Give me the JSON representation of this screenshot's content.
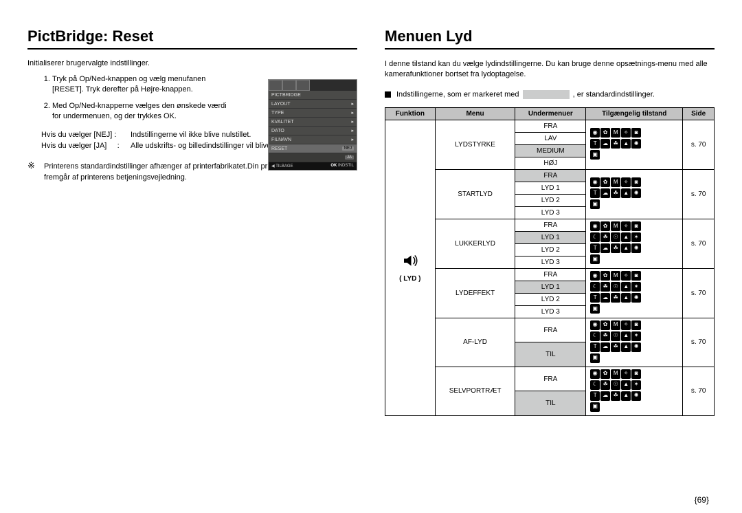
{
  "left": {
    "title": "PictBridge: Reset",
    "intro": "Initialiserer brugervalgte indstillinger.",
    "step1": "Tryk på Op/Ned-knappen og vælg menufanen [RESET]. Tryk derefter på Højre-knappen.",
    "step2": "Med Op/Ned-knapperne vælges den ønskede værdi for undermenuen, og der trykkes OK.",
    "nej_label": "Hvis du vælger [NEJ]",
    "nej_colon": ":",
    "nej_desc": "Indstillingerne vil ikke blive nulstillet.",
    "ja_label": "Hvis du vælger [JA]",
    "ja_colon": ":",
    "ja_desc": "Alle udskrifts- og billedindstillinger vil blive nulstillet.",
    "note": "Printerens standardindstillinger afhænger af printerfabrikatet.Din printers standardindstillinger fremgår af printerens betjeningsvejledning.",
    "note_glyph": "※",
    "screenshot": {
      "title": "PICTBRIDGE",
      "items": [
        "LAYOUT",
        "TYPE",
        "KVALITET",
        "DATO",
        "FILNAVN",
        "RESET"
      ],
      "reset_opts": [
        "NEJ",
        "JA"
      ],
      "bottom_back_arrow": "◀",
      "bottom_back": "TILBAGE",
      "bottom_ok": "OK",
      "bottom_set": "INDSTIL"
    }
  },
  "right": {
    "title": "Menuen Lyd",
    "intro": "I denne tilstand kan du vælge lydindstillingerne. Du kan bruge denne opsætnings-menu med alle kamerafunktioner bortset fra lydoptagelse.",
    "bullet_prefix": "Indstillingerne, som er markeret med",
    "bullet_suffix": ", er standardindstillinger.",
    "headers": {
      "funktion": "Funktion",
      "menu": "Menu",
      "undermenuer": "Undermenuer",
      "tilstand": "Tilgængelig tilstand",
      "side": "Side"
    },
    "funktion_label": "( LYD )",
    "menus": {
      "lydstyrke": {
        "name": "LYDSTYRKE",
        "subs": [
          "FRA",
          "LAV",
          "MEDIUM",
          "HØJ"
        ],
        "default_idx": 2,
        "page": "s. 70"
      },
      "startlyd": {
        "name": "STARTLYD",
        "subs": [
          "FRA",
          "LYD 1",
          "LYD 2",
          "LYD 3"
        ],
        "default_idx": 0,
        "page": "s. 70"
      },
      "lukkerlyd": {
        "name": "LUKKERLYD",
        "subs": [
          "FRA",
          "LYD 1",
          "LYD 2",
          "LYD 3"
        ],
        "default_idx": 1,
        "page": "s. 70"
      },
      "lydeffekt": {
        "name": "LYDEFFEKT",
        "subs": [
          "FRA",
          "LYD 1",
          "LYD 2",
          "LYD 3"
        ],
        "default_idx": 1,
        "page": "s. 70"
      },
      "aflyd": {
        "name": "AF-LYD",
        "subs": [
          "FRA",
          "TIL"
        ],
        "default_idx": 1,
        "page": "s. 70"
      },
      "selvportraet": {
        "name": "SELVPORTRÆT",
        "subs": [
          "FRA",
          "TIL"
        ],
        "default_idx": 1,
        "page": "s. 70"
      }
    }
  },
  "page_num": "{69}"
}
